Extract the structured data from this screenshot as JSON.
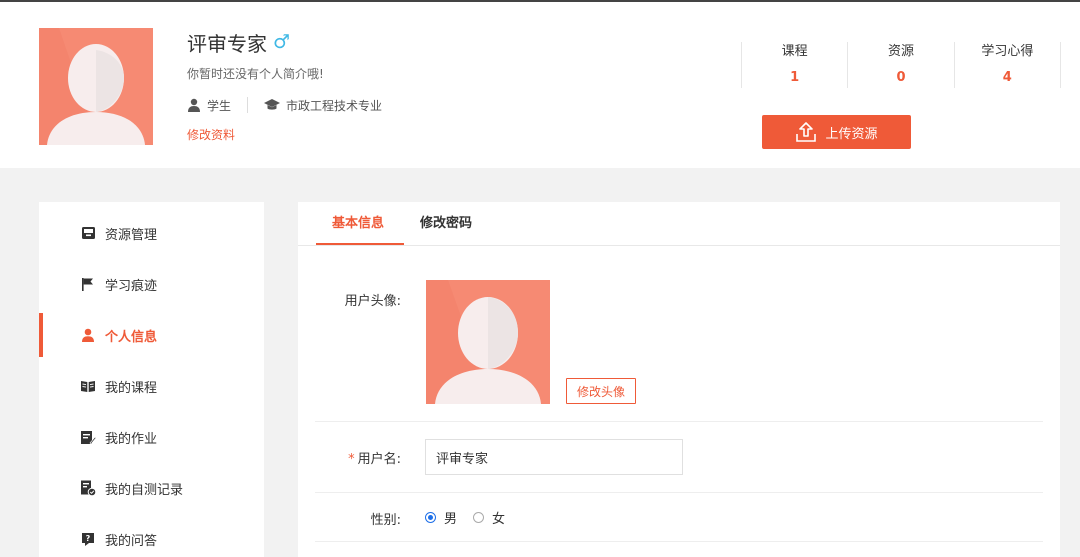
{
  "profile": {
    "name": "评审专家",
    "gender_icon": "male-icon",
    "intro": "你暂时还没有个人简介哦!",
    "role": "学生",
    "major": "市政工程技术专业",
    "edit_link": "修改资料"
  },
  "stats": [
    {
      "label": "课程",
      "value": "1"
    },
    {
      "label": "资源",
      "value": "0"
    },
    {
      "label": "学习心得",
      "value": "4"
    }
  ],
  "upload_button": "上传资源",
  "sidebar": {
    "items": [
      {
        "label": "资源管理",
        "icon": "inbox-icon"
      },
      {
        "label": "学习痕迹",
        "icon": "flag-icon"
      },
      {
        "label": "个人信息",
        "icon": "user-icon",
        "active": true
      },
      {
        "label": "我的课程",
        "icon": "book-icon"
      },
      {
        "label": "我的作业",
        "icon": "homework-icon"
      },
      {
        "label": "我的自测记录",
        "icon": "test-record-icon"
      },
      {
        "label": "我的问答",
        "icon": "question-icon"
      }
    ]
  },
  "tabs": [
    {
      "label": "基本信息",
      "active": true
    },
    {
      "label": "修改密码",
      "active": false
    }
  ],
  "form": {
    "avatar_label": "用户头像:",
    "change_avatar": "修改头像",
    "username_required": "*",
    "username_label": "用户名:",
    "username_value": "评审专家",
    "gender_label": "性别:",
    "gender_options": [
      "男",
      "女"
    ],
    "gender_selected": "男"
  },
  "colors": {
    "accent": "#ef5a38",
    "avatar_bg": "#f4846d",
    "male_icon": "#3fb8e5",
    "radio": "#1e6fe8"
  }
}
